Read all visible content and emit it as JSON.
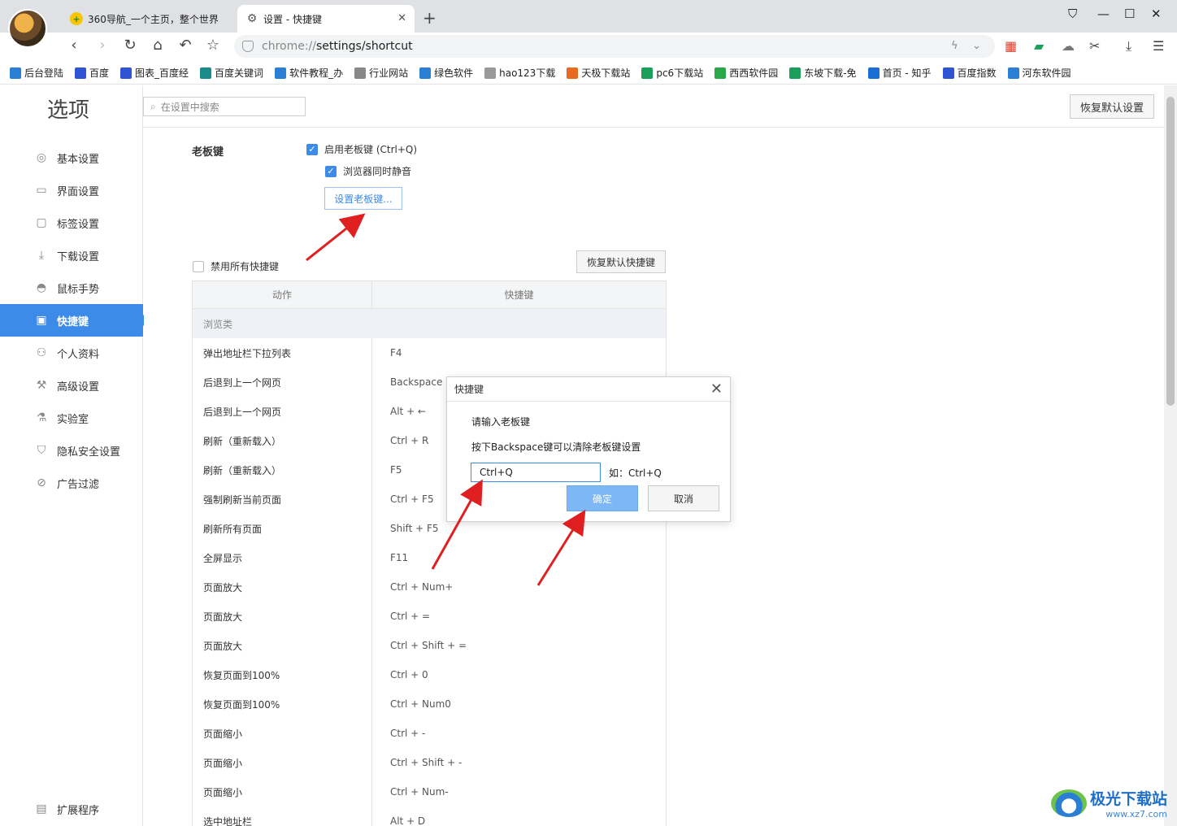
{
  "browser": {
    "tabs": [
      {
        "label": "360导航_一个主页，整个世界",
        "active": false
      },
      {
        "label": "设置 - 快捷键",
        "active": true
      }
    ],
    "url_scheme": "chrome://",
    "url_path": "settings/shortcut",
    "bookmarks": [
      "后台登陆",
      "百度",
      "图表_百度经",
      "百度关键词",
      "软件教程_办",
      "行业网站",
      "绿色软件",
      "hao123下载",
      "天极下载站",
      "pc6下载站",
      "西西软件园",
      "东坡下载-免",
      "首页 - 知乎",
      "百度指数",
      "河东软件园"
    ]
  },
  "settings": {
    "page_title": "选项",
    "search_placeholder": "在设置中搜索",
    "restore_all_label": "恢复默认设置",
    "sidebar": [
      {
        "label": "基本设置",
        "icon": "settings-icon"
      },
      {
        "label": "界面设置",
        "icon": "window-icon"
      },
      {
        "label": "标签设置",
        "icon": "tab-icon"
      },
      {
        "label": "下载设置",
        "icon": "download-icon"
      },
      {
        "label": "鼠标手势",
        "icon": "mouse-icon"
      },
      {
        "label": "快捷键",
        "icon": "keyboard-icon",
        "active": true
      },
      {
        "label": "个人资料",
        "icon": "user-icon"
      },
      {
        "label": "高级设置",
        "icon": "wrench-icon"
      },
      {
        "label": "实验室",
        "icon": "flask-icon"
      },
      {
        "label": "隐私安全设置",
        "icon": "shield-icon"
      },
      {
        "label": "广告过滤",
        "icon": "block-icon"
      }
    ],
    "extensions_label": "扩展程序",
    "boss_key": {
      "section_label": "老板键",
      "enable_label": "启用老板键 (Ctrl+Q)",
      "mute_label": "浏览器同时静音",
      "set_button": "设置老板键..."
    },
    "disable_all_label": "禁用所有快捷键",
    "restore_keys_label": "恢复默认快捷键",
    "table": {
      "headers": [
        "动作",
        "快捷键"
      ],
      "group": "浏览类",
      "rows": [
        [
          "弹出地址栏下拉列表",
          "F4"
        ],
        [
          "后退到上一个网页",
          "Backspace"
        ],
        [
          "后退到上一个网页",
          "Alt + ←"
        ],
        [
          "刷新（重新载入）",
          "Ctrl + R"
        ],
        [
          "刷新（重新载入）",
          "F5"
        ],
        [
          "强制刷新当前页面",
          "Ctrl + F5"
        ],
        [
          "刷新所有页面",
          "Shift + F5"
        ],
        [
          "全屏显示",
          "F11"
        ],
        [
          "页面放大",
          "Ctrl + Num+"
        ],
        [
          "页面放大",
          "Ctrl + ="
        ],
        [
          "页面放大",
          "Ctrl + Shift + ="
        ],
        [
          "恢复页面到100%",
          "Ctrl + 0"
        ],
        [
          "恢复页面到100%",
          "Ctrl + Num0"
        ],
        [
          "页面缩小",
          "Ctrl + -"
        ],
        [
          "页面缩小",
          "Ctrl + Shift + -"
        ],
        [
          "页面缩小",
          "Ctrl + Num-"
        ],
        [
          "选中地址栏",
          "Alt + D"
        ]
      ]
    }
  },
  "dialog": {
    "title": "快捷键",
    "prompt": "请输入老板键",
    "hint": "按下Backspace键可以清除老板键设置",
    "input_value": "Ctrl+Q",
    "example": "如：Ctrl+Q",
    "ok_label": "确定",
    "cancel_label": "取消"
  },
  "watermark": {
    "name": "极光下载站",
    "url": "www.xz7.com"
  },
  "colors": {
    "accent": "#3d8be8",
    "arrow": "#e02020"
  }
}
